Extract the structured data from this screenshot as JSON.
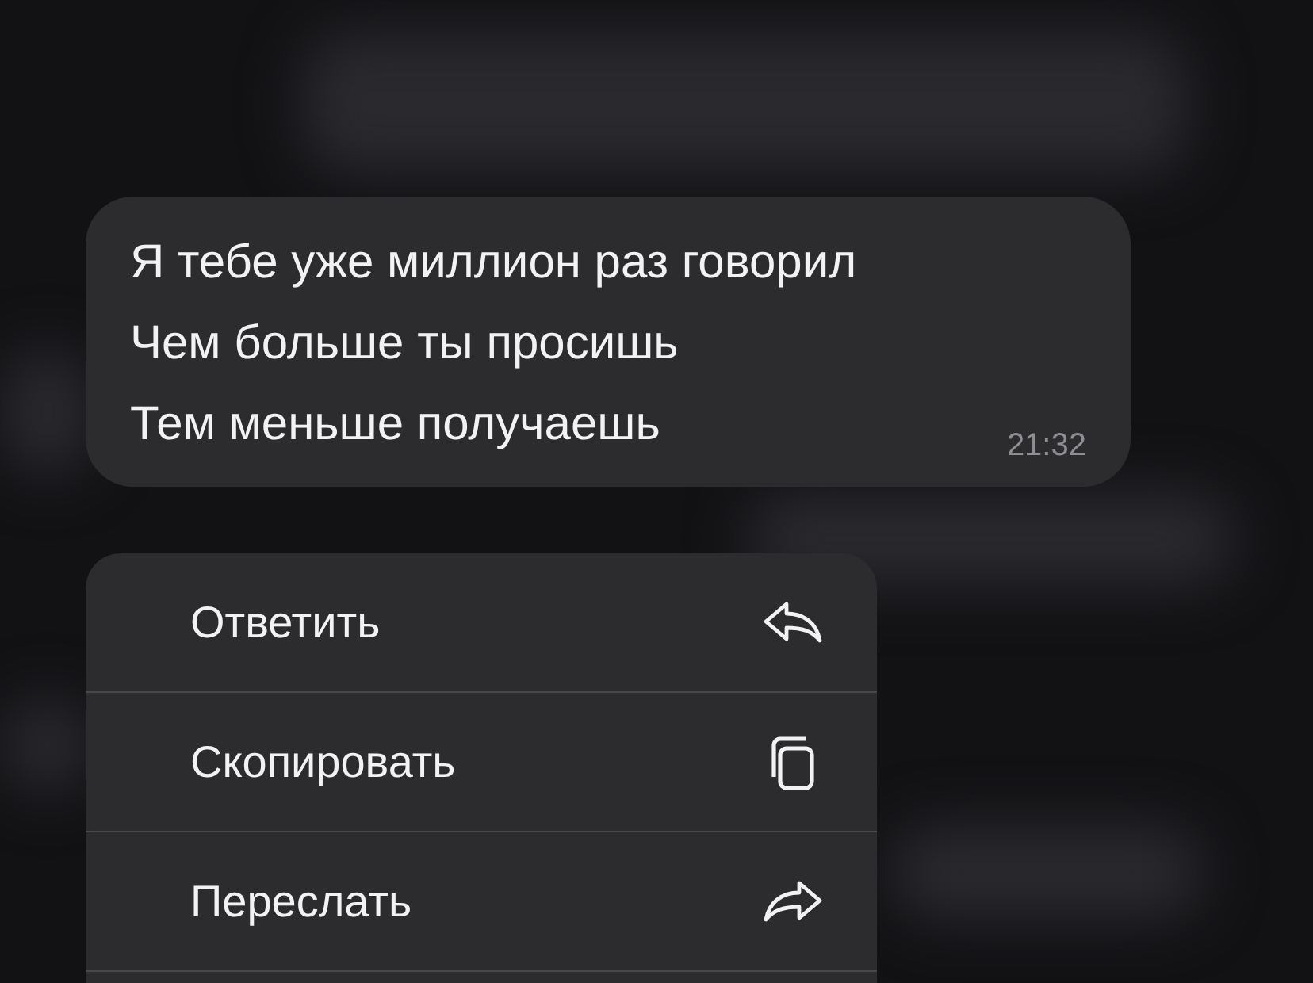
{
  "message": {
    "lines": [
      "Я тебе уже миллион раз говорил",
      "Чем больше ты просишь",
      "Тем меньше получаешь"
    ],
    "time": "21:32"
  },
  "menu": {
    "items": [
      {
        "label": "Ответить",
        "kind": "reply"
      },
      {
        "label": "Скопировать",
        "kind": "copy"
      },
      {
        "label": "Переслать",
        "kind": "forward"
      }
    ]
  }
}
